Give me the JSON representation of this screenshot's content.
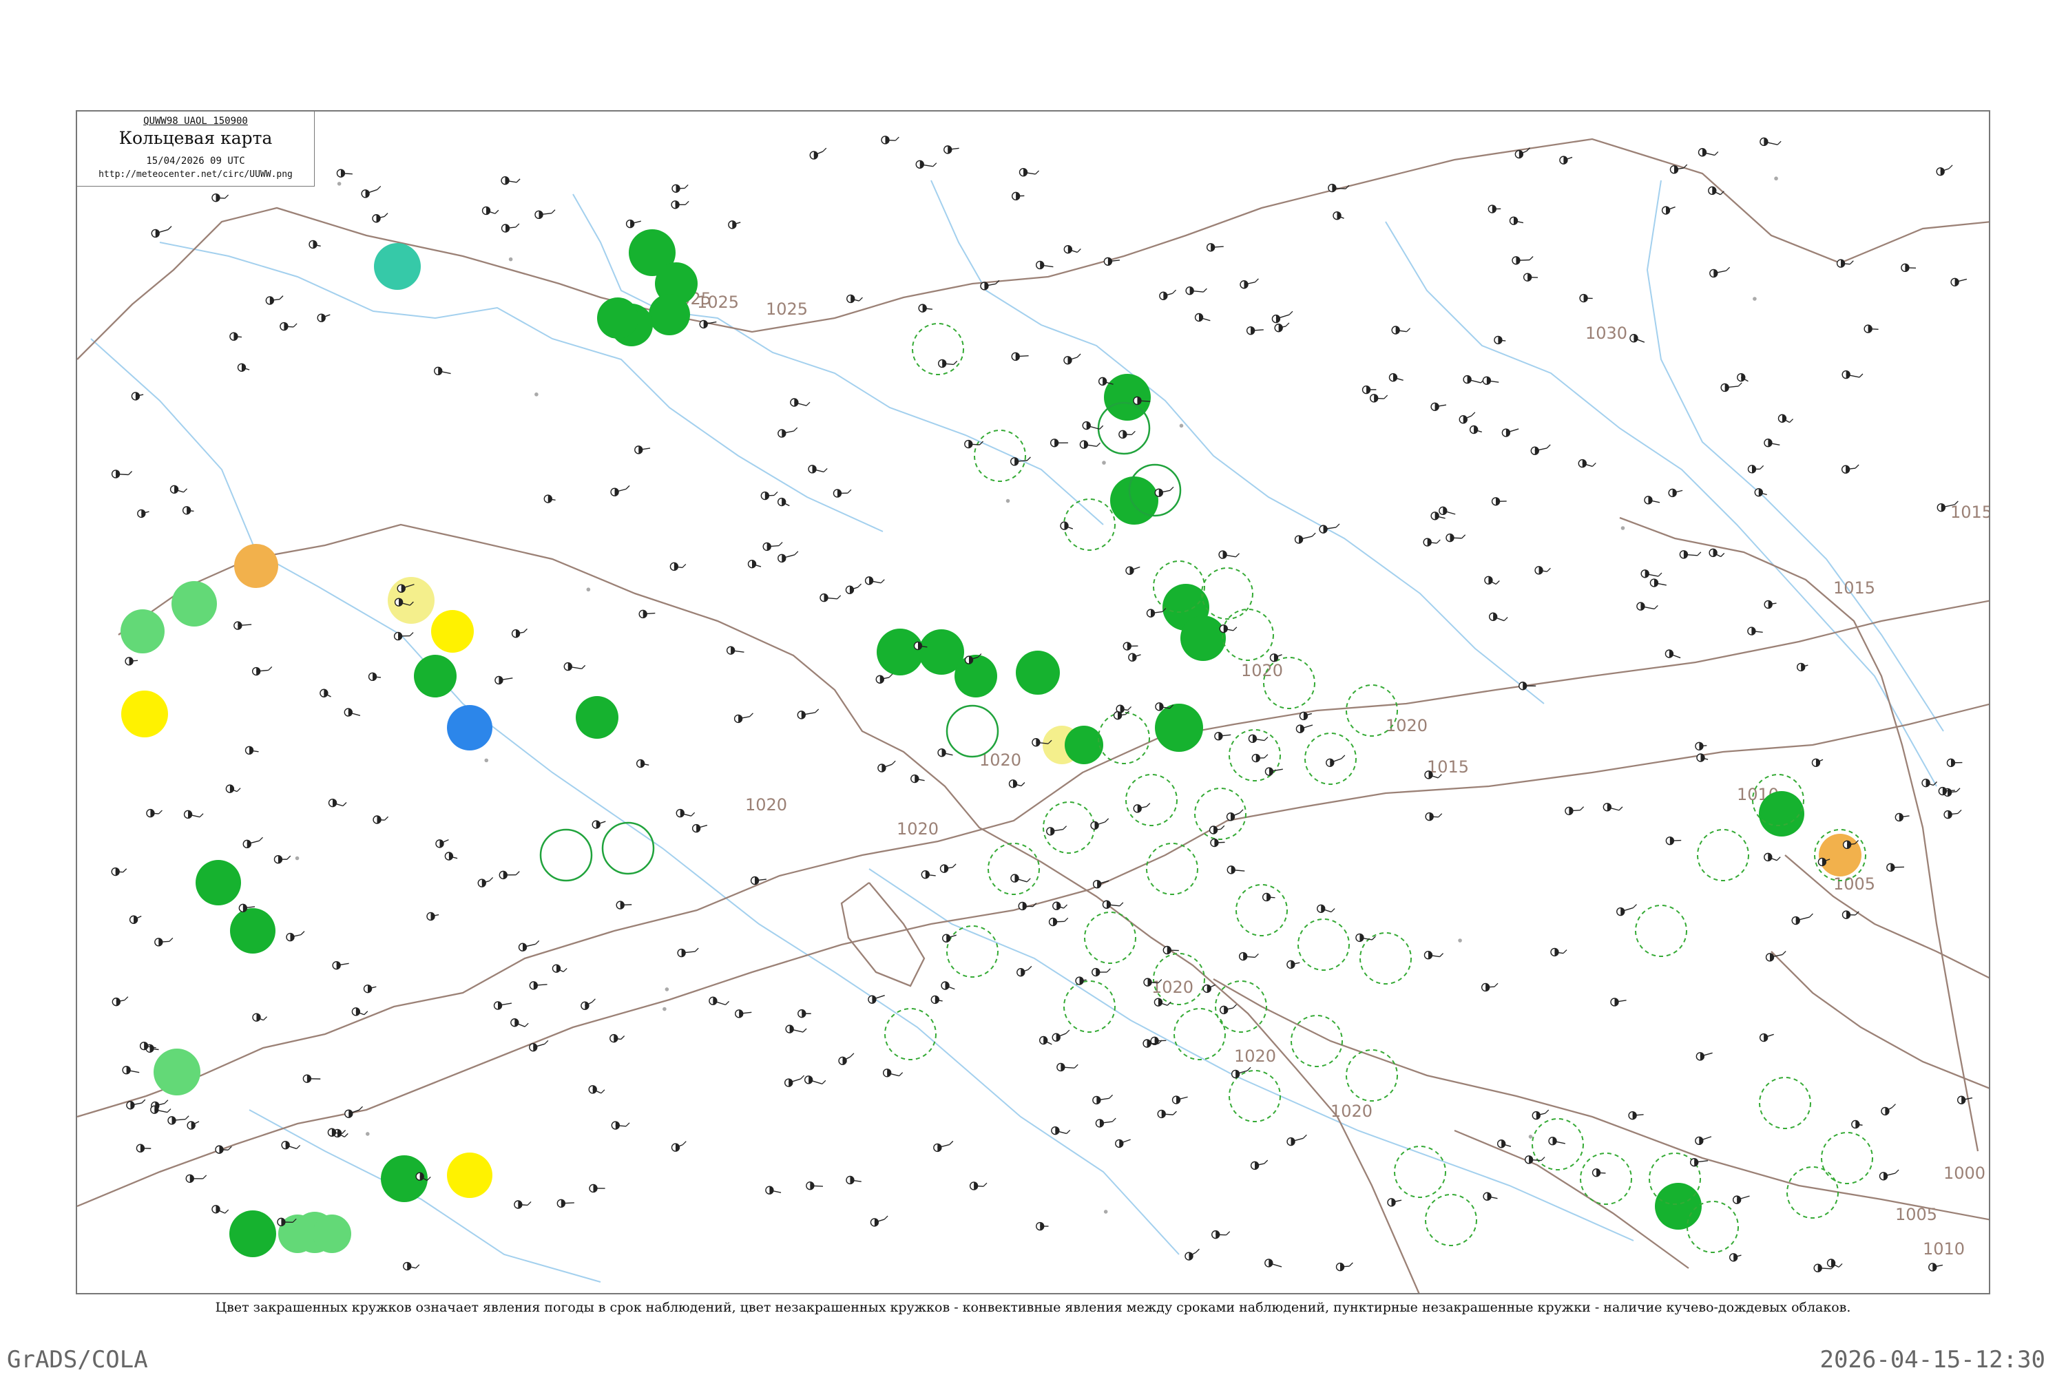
{
  "header": {
    "code": "QUWW98 UAOL 150900",
    "title": "Кольцевая карта",
    "time": "15/04/2026 09 UTC",
    "url": "http://meteocenter.net/circ/UUWW.png"
  },
  "legend": {
    "caption": "Цвет закрашенных кружков означает явления погоды в срок наблюдений, цвет незакрашенных кружков - конвективные явления между сроками наблюдений, пунктирные незакрашенные кружки - наличие кучево-дождевых облаков."
  },
  "footer": {
    "left": "GrADS/COLA",
    "right": "2026-04-15-12:30"
  },
  "isobar_labels": [
    "1025",
    "1025",
    "1025",
    "1030",
    "1020",
    "1020",
    "1020",
    "1020",
    "1020",
    "1020",
    "1020",
    "1015",
    "1015",
    "1015",
    "1010",
    "1005",
    "1000",
    "1005",
    "1010",
    "1020"
  ],
  "colors": {
    "background": "#ffffff",
    "frame": "#777777",
    "river": "#8cc4ea",
    "isobar": "#9b8176",
    "station": "#222222",
    "light_green": "#63d977",
    "green": "#16b22f",
    "dark_green": "#0e9b24",
    "yellow": "#fff200",
    "pale_yellow": "#f4ef8c",
    "orange": "#f2b14c",
    "blue": "#2c86ea",
    "teal": "#36c9a8",
    "dashed": "#35aa35",
    "text_gray": "#666666"
  }
}
